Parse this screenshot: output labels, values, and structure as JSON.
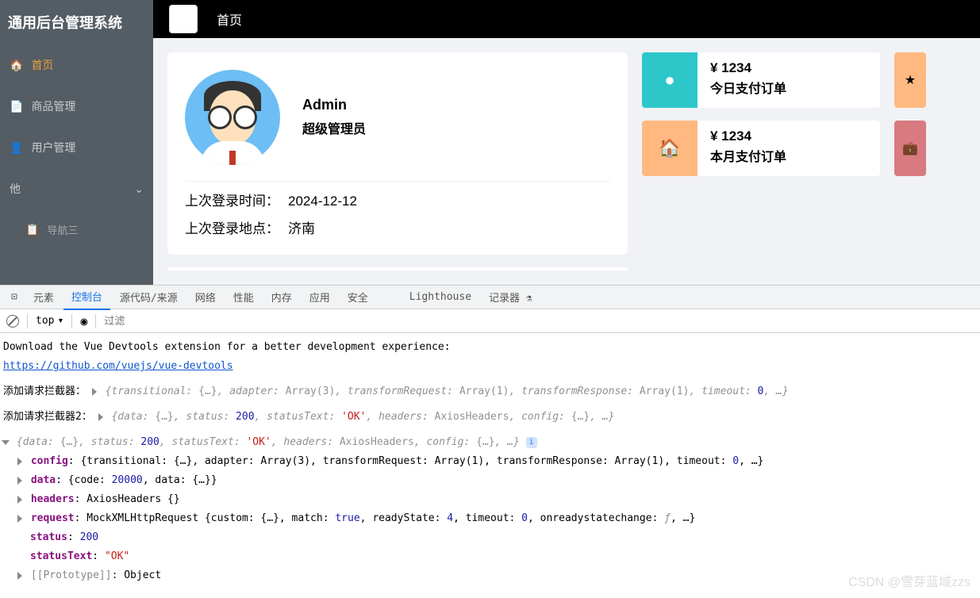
{
  "sidebar": {
    "title": "通用后台管理系统",
    "items": [
      {
        "label": "首页",
        "icon": "🏠"
      },
      {
        "label": "商品管理",
        "icon": "📄"
      },
      {
        "label": "用户管理",
        "icon": "👤"
      },
      {
        "label": "他",
        "icon": ""
      },
      {
        "label": "导航三",
        "icon": "📋"
      }
    ]
  },
  "header": {
    "breadcrumb": "首页"
  },
  "user": {
    "name": "Admin",
    "role": "超级管理员",
    "last_time_label": "上次登录时间：",
    "last_time_value": "2024-12-12",
    "last_loc_label": "上次登录地点：",
    "last_loc_value": "济南"
  },
  "stats": [
    {
      "value": "¥ 1234",
      "label": "今日支付订单",
      "color": "#2ec7c9",
      "icon": "✓"
    },
    {
      "value": "¥ 1234",
      "label": "本月支付订单",
      "color": "#ffb980",
      "icon": "🏠"
    }
  ],
  "stat_badges": [
    {
      "color": "#ffb980",
      "icon": "★"
    },
    {
      "color": "#d87a80",
      "icon": "💼"
    }
  ],
  "devtools": {
    "tabs": [
      "元素",
      "控制台",
      "源代码/来源",
      "网络",
      "性能",
      "内存",
      "应用",
      "安全",
      "Lighthouse",
      "记录器"
    ],
    "active_tab": "控制台",
    "top_label": "top",
    "filter_placeholder": "过滤",
    "msg1": "Download the Vue Devtools extension for a better development experience:",
    "link": "https://github.com/vuejs/vue-devtools",
    "log1_label": "添加请求拦截器：",
    "log1_body": "{transitional: {…}, adapter: Array(3), transformRequest: Array(1), transformResponse: Array(1), timeout: 0, …}",
    "log2_label": "添加请求拦截器2：",
    "log2_body": "{data: {…}, status: 200, statusText: 'OK', headers: AxiosHeaders, config: {…}, …}",
    "expand": {
      "summary": "{data: {…}, status: 200, statusText: 'OK', headers: AxiosHeaders, config: {…}, …}",
      "config": "{transitional: {…}, adapter: Array(3), transformRequest: Array(1), transformResponse: Array(1), timeout: 0, …}",
      "data": "{code: 20000, data: {…}}",
      "headers": "AxiosHeaders {}",
      "request": "MockXMLHttpRequest {custom: {…}, match: true, readyState: 4, timeout: 0, onreadystatechange: ƒ, …}",
      "status": "200",
      "statusText": "\"OK\"",
      "proto": "Object"
    }
  },
  "watermark": "CSDN @雪芽蓝域zzs"
}
